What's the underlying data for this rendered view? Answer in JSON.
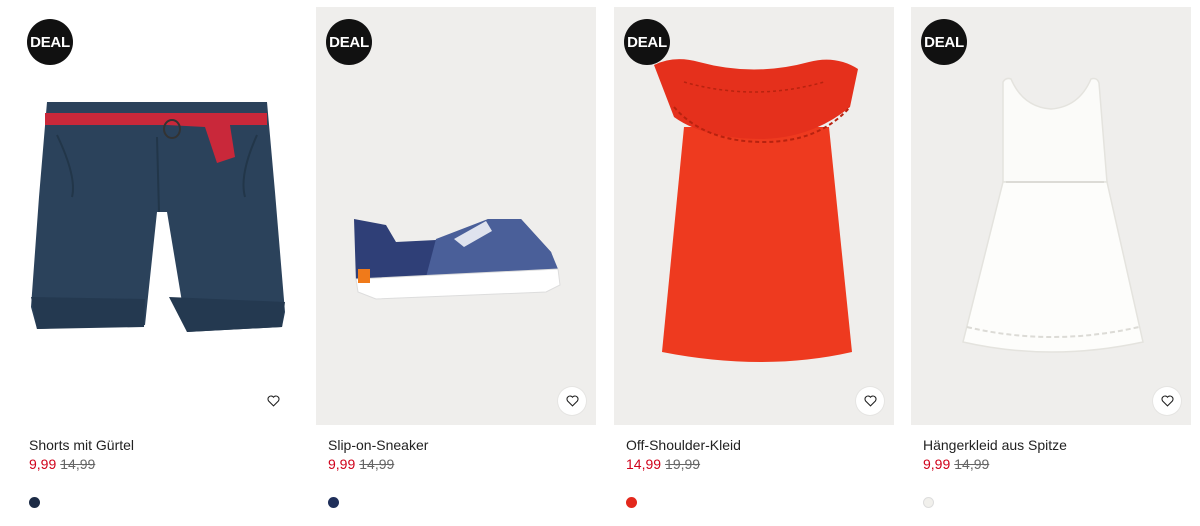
{
  "products": [
    {
      "badge": "DEAL",
      "name": "Shorts mit Gürtel",
      "price": "9,99",
      "old_price": "14,99",
      "swatch_color": "#1c2b45",
      "favorite_icon": "heart-outline-icon"
    },
    {
      "badge": "DEAL",
      "name": "Slip-on-Sneaker",
      "price": "9,99",
      "old_price": "14,99",
      "swatch_color": "#1f2f5a",
      "favorite_icon": "heart-outline-icon"
    },
    {
      "badge": "DEAL",
      "name": "Off-Shoulder-Kleid",
      "price": "14,99",
      "old_price": "19,99",
      "swatch_color": "#e3281c",
      "favorite_icon": "heart-outline-icon"
    },
    {
      "badge": "DEAL",
      "name": "Hängerkleid aus Spitze",
      "price": "9,99",
      "old_price": "14,99",
      "swatch_color": "#f1f0ec",
      "favorite_icon": "heart-outline-icon"
    }
  ],
  "colors": {
    "sale": "#d0021b",
    "badge_bg": "#111111",
    "image_bg": "#efeeec"
  }
}
